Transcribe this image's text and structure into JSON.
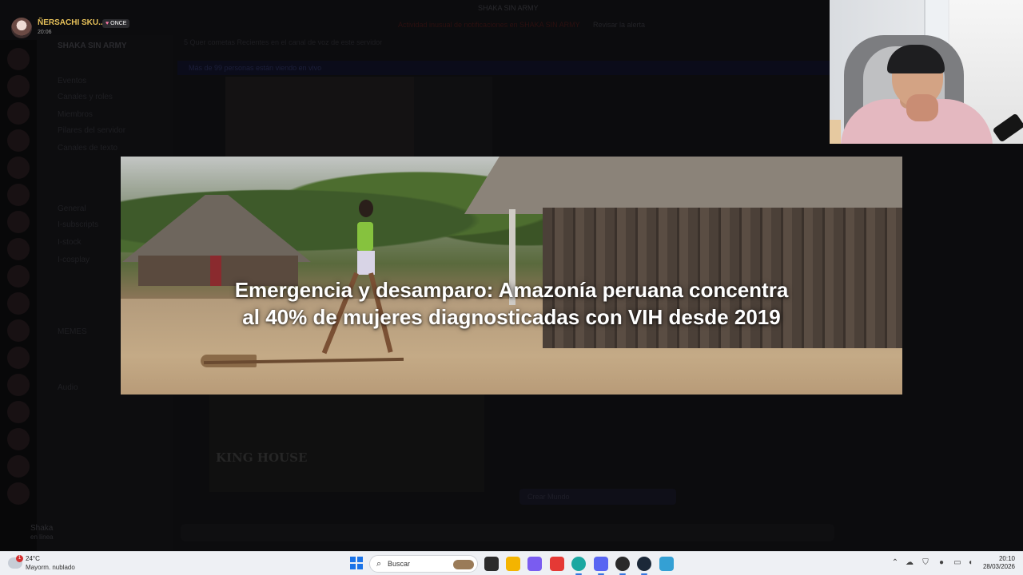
{
  "streamer": {
    "name": "ÑERSACHI SKU...",
    "time": "20:06",
    "badge": "ONCE"
  },
  "discord": {
    "server_name": "SHAKA SIN ARMY",
    "top_title": "SHAKA SIN ARMY",
    "notification": "Actividad inusual de notificaciones en SHAKA SIN ARMY",
    "notification_link": "Revisar la alerta",
    "channel_header": "5 Quer cometas    Recientes en el canal de voz de este servidor",
    "banner": "Más de 99 personas están viendo en vivo",
    "channels": [
      "Eventos",
      "Canales y roles",
      "Miembros",
      "Pilares del servidor",
      "Canales de texto",
      "General",
      "I-subscripts",
      "I-stock",
      "I-cosplay",
      "MEMES",
      "Audio"
    ],
    "sketch_logo": "KING HOUSE",
    "pill_text": "Crear Mundo",
    "user_name": "Shaka",
    "user_status": "en línea"
  },
  "news": {
    "headline": "Emergencia y desamparo: Amazonía peruana concentra al 40% de mujeres diagnosticadas con VIH desde 2019"
  },
  "taskbar": {
    "weather_temp": "24°C",
    "weather_desc": "Mayorm. nublado",
    "weather_alert": "1",
    "search_placeholder": "Buscar",
    "clock_time": "20:10",
    "clock_date": "28/03/2026",
    "apps": [
      {
        "name": "task-view-icon",
        "color": "#2b2b2b"
      },
      {
        "name": "file-explorer-icon",
        "color": "#f4b400"
      },
      {
        "name": "copilot-icon",
        "color": "#7a5cf0"
      },
      {
        "name": "wps-office-icon",
        "color": "#e53935"
      },
      {
        "name": "edge-icon",
        "color": "#1aa7a1"
      },
      {
        "name": "discord-icon",
        "color": "#5865f2"
      },
      {
        "name": "obs-icon",
        "color": "#2a2a2a"
      },
      {
        "name": "steam-icon",
        "color": "#1b2838"
      },
      {
        "name": "notepad-icon",
        "color": "#34a0d4"
      }
    ]
  },
  "colors": {
    "accent": "#5865f2",
    "streamer_name": "#e8c25a",
    "headline_text": "#ffffff"
  }
}
